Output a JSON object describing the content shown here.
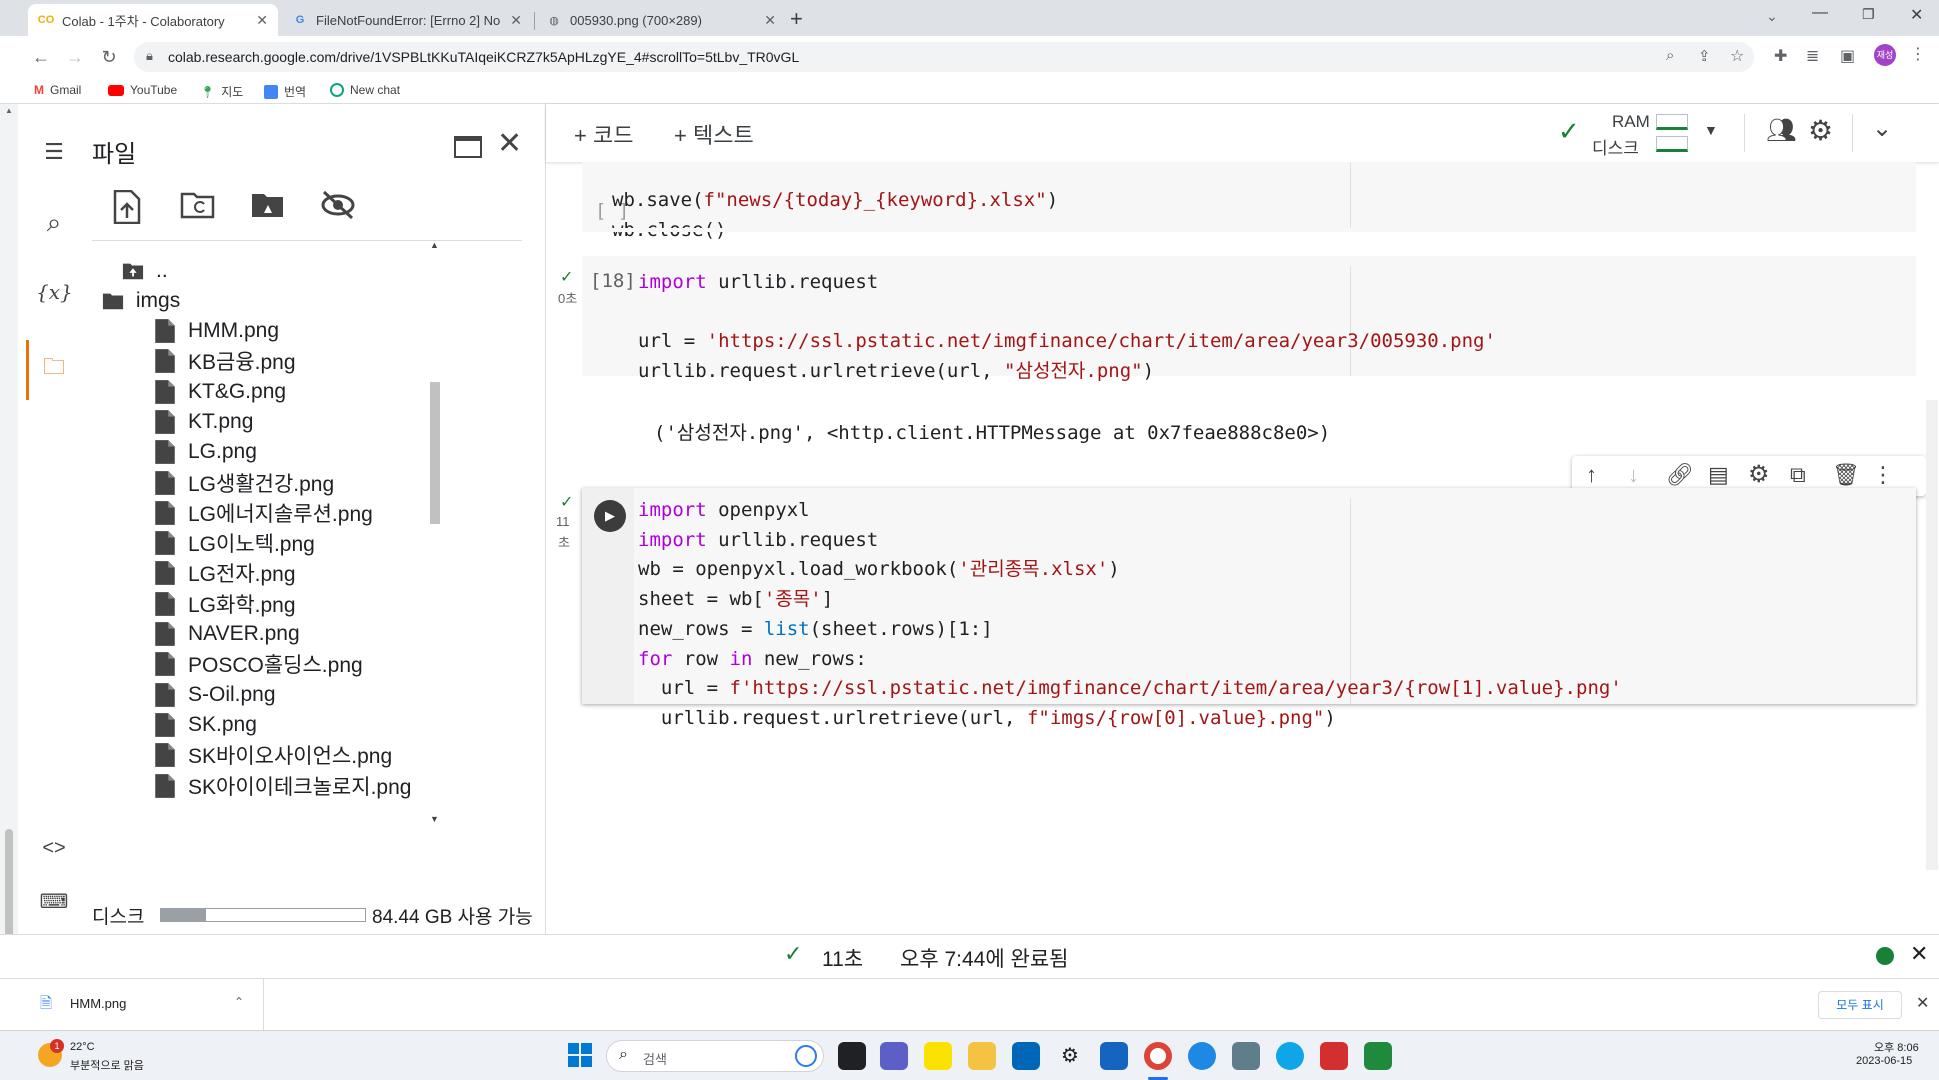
{
  "tabs": [
    {
      "title": "Colab - 1주차 - Colaboratory",
      "active": true
    },
    {
      "title": "FileNotFoundError: [Errno 2] No",
      "active": false
    },
    {
      "title": "005930.png (700×289)",
      "active": false
    }
  ],
  "address": {
    "url": "colab.research.google.com/drive/1VSPBLtKKuTAIqeiKCRZ7k5ApHLzgYE_4#scrollTo=5tLbv_TR0vGL"
  },
  "bookmarks": [
    "Gmail",
    "YouTube",
    "지도",
    "번역",
    "New chat"
  ],
  "profile_initials": "재성",
  "files": {
    "title": "파일",
    "parent": "..",
    "folder": "imgs",
    "items": [
      "HMM.png",
      "KB금융.png",
      "KT&G.png",
      "KT.png",
      "LG.png",
      "LG생활건강.png",
      "LG에너지솔루션.png",
      "LG이노텍.png",
      "LG전자.png",
      "LG화학.png",
      "NAVER.png",
      "POSCO홀딩스.png",
      "S-Oil.png",
      "SK.png",
      "SK바이오사이언스.png",
      "SK아이이테크놀로지.png"
    ],
    "disk_label": "디스크",
    "disk_free": "84.44 GB 사용 가능",
    "disk_used_fraction": 0.22
  },
  "toolbar": {
    "add_code": "+ 코드",
    "add_text": "+ 텍스트",
    "ram": "RAM",
    "disk": "디스크"
  },
  "cells": {
    "c1": {
      "count": "[ ]",
      "lines": [
        "wb.save(f\"news/{today}_{keyword}.xlsx\")",
        "wb.close()"
      ]
    },
    "c2": {
      "count": "[18]",
      "exec": "0초",
      "output": "('삼성전자.png', <http.client.HTTPMessage at 0x7feae888c8e0>)"
    },
    "c3": {
      "exec1": "11",
      "exec2": "초"
    }
  },
  "status": {
    "time": "11초",
    "message": "오후 7:44에 완료됨"
  },
  "download": {
    "file": "HMM.png",
    "show_all": "모두 표시"
  },
  "taskbar": {
    "weather_temp": "22°C",
    "weather_desc": "부분적으로 맑음",
    "search": "검색",
    "time": "오후 8:06",
    "date": "2023-06-15",
    "badge": "1"
  }
}
